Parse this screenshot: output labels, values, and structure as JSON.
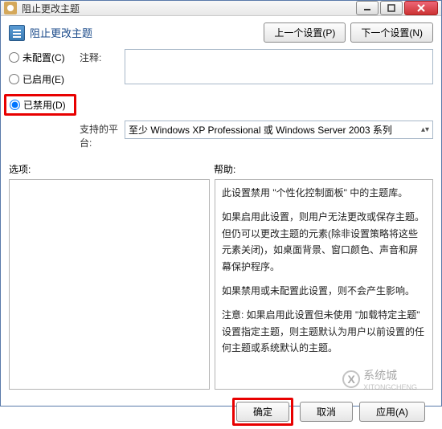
{
  "window": {
    "title": "阻止更改主题"
  },
  "header": {
    "title": "阻止更改主题",
    "prev_btn": "上一个设置(P)",
    "next_btn": "下一个设置(N)"
  },
  "radios": {
    "not_configured": "未配置(C)",
    "enabled": "已启用(E)",
    "disabled": "已禁用(D)",
    "selected": "disabled"
  },
  "labels": {
    "comment": "注释:",
    "platform": "支持的平台:",
    "options": "选项:",
    "help": "帮助:"
  },
  "fields": {
    "comment_value": "",
    "platform_value": "至少 Windows XP Professional 或 Windows Server 2003 系列"
  },
  "help_text": {
    "p1": "此设置禁用 \"个性化控制面板\" 中的主题库。",
    "p2": "如果启用此设置，则用户无法更改或保存主题。但仍可以更改主题的元素(除非设置策略将这些元素关闭)，如桌面背景、窗口颜色、声音和屏幕保护程序。",
    "p3": "如果禁用或未配置此设置，则不会产生影响。",
    "p4": "注意: 如果启用此设置但未使用 \"加载特定主题\" 设置指定主题，则主题默认为用户以前设置的任何主题或系统默认的主题。"
  },
  "footer": {
    "ok": "确定",
    "cancel": "取消",
    "apply": "应用(A)"
  },
  "watermark": {
    "brand": "系统城",
    "url": "XITONGCHENG"
  }
}
